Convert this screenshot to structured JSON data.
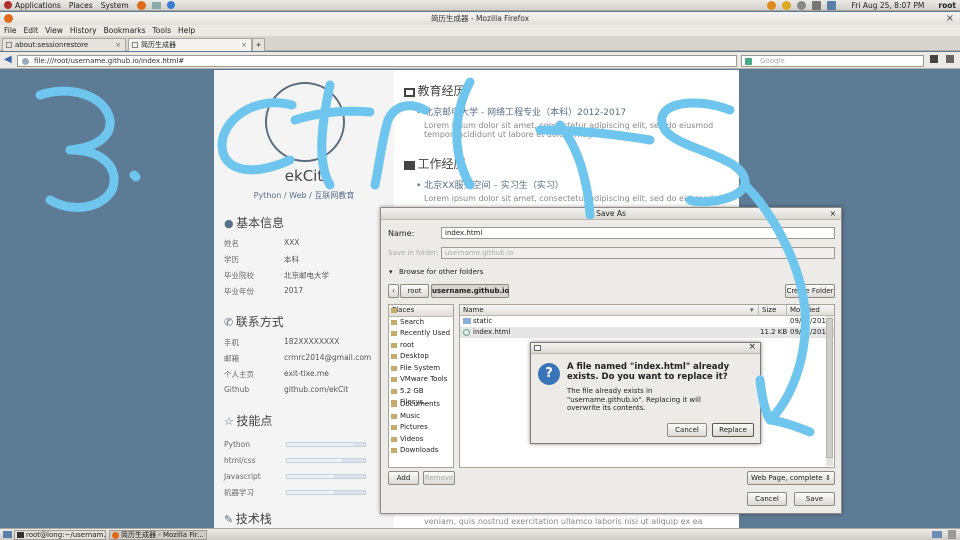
{
  "panel": {
    "menus": [
      "Applications",
      "Places",
      "System"
    ],
    "datetime": "Fri Aug 25,  8:07 PM",
    "user": "root"
  },
  "window": {
    "title": "简历生成器 - Mozilla Firefox",
    "close": "×"
  },
  "menubar": [
    "File",
    "Edit",
    "View",
    "History",
    "Bookmarks",
    "Tools",
    "Help"
  ],
  "tabs": [
    {
      "label": "about:sessionrestore"
    },
    {
      "label": "简历生成器"
    }
  ],
  "navbar": {
    "url": "file:///root/username.github.io/index.html#",
    "search_placeholder": "Google"
  },
  "resume": {
    "name": "ekCit",
    "tagline": "Python / Web / 互联网教育",
    "basic_title": "基本信息",
    "basic": [
      {
        "k": "姓名",
        "v": "XXX"
      },
      {
        "k": "学历",
        "v": "本科"
      },
      {
        "k": "毕业院校",
        "v": "北京邮电大学"
      },
      {
        "k": "毕业年份",
        "v": "2017"
      }
    ],
    "contact_title": "联系方式",
    "contact": [
      {
        "k": "手机",
        "v": "182XXXXXXXX"
      },
      {
        "k": "邮箱",
        "v": "crmrc2014@gmail.com"
      },
      {
        "k": "个人主页",
        "v": "exit-tixe.me"
      },
      {
        "k": "Github",
        "v": "github.com/ekCit"
      }
    ],
    "skills_title": "技能点",
    "skills": [
      {
        "k": "Python",
        "level": 0.85
      },
      {
        "k": "html/css",
        "level": 0.7
      },
      {
        "k": "Javascript",
        "level": 0.6
      },
      {
        "k": "机器学习",
        "level": 0.6
      }
    ],
    "stack_title": "技术栈",
    "edu_title": "教育经历",
    "edu_item": "北京邮电大学 - 网络工程专业（本科）2012-2017",
    "edu_lorem": "Lorem ipsum dolor sit amet, consectetur adipiscing elit, sed do eiusmod",
    "edu_lorem2": "tempor incididunt ut labore et dolore magna aliqua.",
    "work_title": "工作经历",
    "work_item": "北京XX服务空间 – 实习生（实习）",
    "work_lorem": "Lorem ipsum dolor sit amet, consectetur adipiscing elit, sed do eiusmod",
    "bottom_lorem": "veniam, quis nostrud exercitation ullamco laboris nisi ut aliquip ex ea"
  },
  "save_dialog": {
    "title": "Save As",
    "name_label": "Name:",
    "name_value": "index.html",
    "folder_label": "Save in folder:",
    "folder_value": "username.github.io",
    "browse_label": "Browse for other folders",
    "path": [
      "root",
      "username.github.io"
    ],
    "create_folder": "Create Folder",
    "places_header": "Places",
    "places": [
      "Search",
      "Recently Used",
      "root",
      "Desktop",
      "File System",
      "VMware Tools",
      "5.2 GB Filesys...",
      "Documents",
      "Music",
      "Pictures",
      "Videos",
      "Downloads"
    ],
    "columns": {
      "name": "Name",
      "size": "Size",
      "modified": "Modified"
    },
    "files": [
      {
        "name": "static",
        "size": "",
        "modified": "09/01/2016"
      },
      {
        "name": "index.html",
        "size": "11.2 KB",
        "modified": "09/01/2016"
      }
    ],
    "add": "Add",
    "remove": "Remove",
    "filetype": "Web Page, complete",
    "cancel": "Cancel",
    "save": "Save"
  },
  "alert": {
    "heading": "A file named \"index.html\" already exists.  Do you want to replace it?",
    "body": "The file already exists in \"username.github.io\".  Replacing it will overwrite its contents.",
    "cancel": "Cancel",
    "replace": "Replace"
  },
  "taskbar": [
    {
      "label": "root@long:~/usernam..."
    },
    {
      "label": "简历生成器 - Mozilla Fir..."
    }
  ],
  "colors": {
    "page_bg": "#5e7b95",
    "scribble": "#6ec6ef",
    "accent": "#57708a"
  }
}
